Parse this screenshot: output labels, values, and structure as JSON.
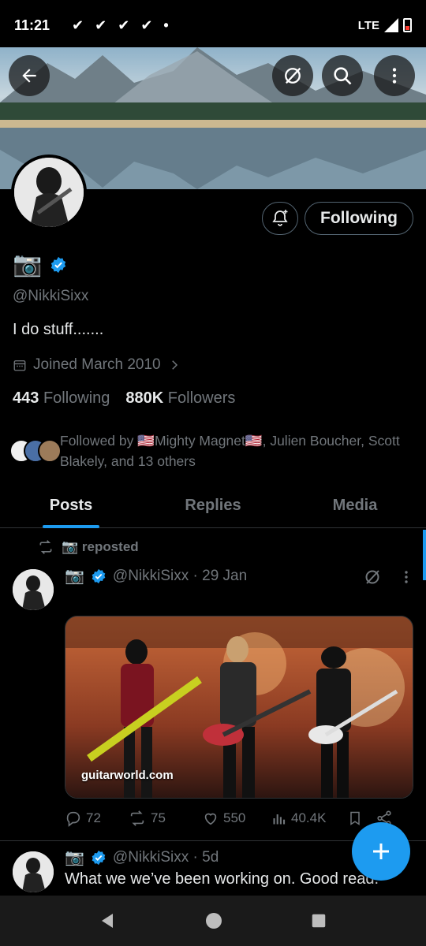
{
  "status_bar": {
    "time": "11:21",
    "network": "LTE",
    "check_icons": [
      "check-icon",
      "check-icon",
      "check-icon",
      "check-icon"
    ],
    "dot": "•"
  },
  "header": {
    "buttons": [
      "back-arrow-icon",
      "grok-icon",
      "search-icon",
      "more-vertical-icon"
    ]
  },
  "profile": {
    "display_name": "📷",
    "handle": "@NikkiSixx",
    "bio": "I do stuff.......",
    "joined": "Joined March 2010",
    "following_count": "443",
    "following_label": "Following",
    "followers_count": "880K",
    "followers_label": "Followers",
    "follow_button": "Following",
    "followed_by": "Followed by 🇺🇸Mighty Magnet🇺🇸, Julien Boucher, Scott Blakely, and 13 others"
  },
  "tabs": [
    {
      "label": "Posts",
      "active": true
    },
    {
      "label": "Replies",
      "active": false
    },
    {
      "label": "Media",
      "active": false
    }
  ],
  "posts": [
    {
      "repost_label": "📷 reposted",
      "author_name": "📷",
      "handle_time": "@NikkiSixx · 29 Jan",
      "media_caption": "guitarworld.com",
      "replies": "72",
      "reposts": "75",
      "likes": "550",
      "views": "40.4K"
    },
    {
      "author_name": "📷",
      "handle_time": "@NikkiSixx · 5d",
      "text": "What we we’ve been working on. Good read."
    }
  ],
  "colors": {
    "accent": "#1d9bf0",
    "background": "#000000",
    "muted_text": "#71767b",
    "primary_text": "#e7e9ea"
  }
}
